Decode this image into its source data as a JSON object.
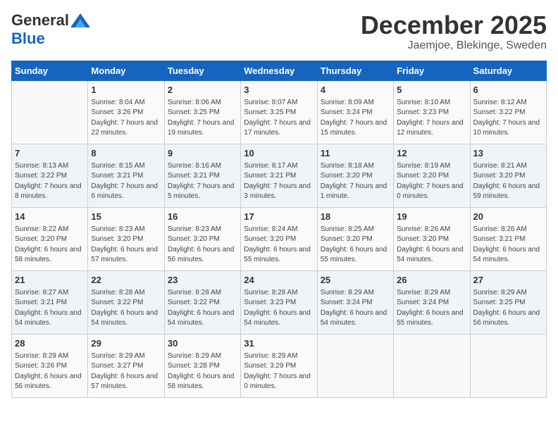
{
  "header": {
    "logo_general": "General",
    "logo_blue": "Blue",
    "month_title": "December 2025",
    "subtitle": "Jaemjoe, Blekinge, Sweden"
  },
  "weekdays": [
    "Sunday",
    "Monday",
    "Tuesday",
    "Wednesday",
    "Thursday",
    "Friday",
    "Saturday"
  ],
  "weeks": [
    [
      {
        "day": "",
        "sunrise": "",
        "sunset": "",
        "daylight": ""
      },
      {
        "day": "1",
        "sunrise": "Sunrise: 8:04 AM",
        "sunset": "Sunset: 3:26 PM",
        "daylight": "Daylight: 7 hours and 22 minutes."
      },
      {
        "day": "2",
        "sunrise": "Sunrise: 8:06 AM",
        "sunset": "Sunset: 3:25 PM",
        "daylight": "Daylight: 7 hours and 19 minutes."
      },
      {
        "day": "3",
        "sunrise": "Sunrise: 8:07 AM",
        "sunset": "Sunset: 3:25 PM",
        "daylight": "Daylight: 7 hours and 17 minutes."
      },
      {
        "day": "4",
        "sunrise": "Sunrise: 8:09 AM",
        "sunset": "Sunset: 3:24 PM",
        "daylight": "Daylight: 7 hours and 15 minutes."
      },
      {
        "day": "5",
        "sunrise": "Sunrise: 8:10 AM",
        "sunset": "Sunset: 3:23 PM",
        "daylight": "Daylight: 7 hours and 12 minutes."
      },
      {
        "day": "6",
        "sunrise": "Sunrise: 8:12 AM",
        "sunset": "Sunset: 3:22 PM",
        "daylight": "Daylight: 7 hours and 10 minutes."
      }
    ],
    [
      {
        "day": "7",
        "sunrise": "Sunrise: 8:13 AM",
        "sunset": "Sunset: 3:22 PM",
        "daylight": "Daylight: 7 hours and 8 minutes."
      },
      {
        "day": "8",
        "sunrise": "Sunrise: 8:15 AM",
        "sunset": "Sunset: 3:21 PM",
        "daylight": "Daylight: 7 hours and 6 minutes."
      },
      {
        "day": "9",
        "sunrise": "Sunrise: 8:16 AM",
        "sunset": "Sunset: 3:21 PM",
        "daylight": "Daylight: 7 hours and 5 minutes."
      },
      {
        "day": "10",
        "sunrise": "Sunrise: 8:17 AM",
        "sunset": "Sunset: 3:21 PM",
        "daylight": "Daylight: 7 hours and 3 minutes."
      },
      {
        "day": "11",
        "sunrise": "Sunrise: 8:18 AM",
        "sunset": "Sunset: 3:20 PM",
        "daylight": "Daylight: 7 hours and 1 minute."
      },
      {
        "day": "12",
        "sunrise": "Sunrise: 8:19 AM",
        "sunset": "Sunset: 3:20 PM",
        "daylight": "Daylight: 7 hours and 0 minutes."
      },
      {
        "day": "13",
        "sunrise": "Sunrise: 8:21 AM",
        "sunset": "Sunset: 3:20 PM",
        "daylight": "Daylight: 6 hours and 59 minutes."
      }
    ],
    [
      {
        "day": "14",
        "sunrise": "Sunrise: 8:22 AM",
        "sunset": "Sunset: 3:20 PM",
        "daylight": "Daylight: 6 hours and 58 minutes."
      },
      {
        "day": "15",
        "sunrise": "Sunrise: 8:23 AM",
        "sunset": "Sunset: 3:20 PM",
        "daylight": "Daylight: 6 hours and 57 minutes."
      },
      {
        "day": "16",
        "sunrise": "Sunrise: 8:23 AM",
        "sunset": "Sunset: 3:20 PM",
        "daylight": "Daylight: 6 hours and 56 minutes."
      },
      {
        "day": "17",
        "sunrise": "Sunrise: 8:24 AM",
        "sunset": "Sunset: 3:20 PM",
        "daylight": "Daylight: 6 hours and 55 minutes."
      },
      {
        "day": "18",
        "sunrise": "Sunrise: 8:25 AM",
        "sunset": "Sunset: 3:20 PM",
        "daylight": "Daylight: 6 hours and 55 minutes."
      },
      {
        "day": "19",
        "sunrise": "Sunrise: 8:26 AM",
        "sunset": "Sunset: 3:20 PM",
        "daylight": "Daylight: 6 hours and 54 minutes."
      },
      {
        "day": "20",
        "sunrise": "Sunrise: 8:26 AM",
        "sunset": "Sunset: 3:21 PM",
        "daylight": "Daylight: 6 hours and 54 minutes."
      }
    ],
    [
      {
        "day": "21",
        "sunrise": "Sunrise: 8:27 AM",
        "sunset": "Sunset: 3:21 PM",
        "daylight": "Daylight: 6 hours and 54 minutes."
      },
      {
        "day": "22",
        "sunrise": "Sunrise: 8:28 AM",
        "sunset": "Sunset: 3:22 PM",
        "daylight": "Daylight: 6 hours and 54 minutes."
      },
      {
        "day": "23",
        "sunrise": "Sunrise: 8:28 AM",
        "sunset": "Sunset: 3:22 PM",
        "daylight": "Daylight: 6 hours and 54 minutes."
      },
      {
        "day": "24",
        "sunrise": "Sunrise: 8:28 AM",
        "sunset": "Sunset: 3:23 PM",
        "daylight": "Daylight: 6 hours and 54 minutes."
      },
      {
        "day": "25",
        "sunrise": "Sunrise: 8:29 AM",
        "sunset": "Sunset: 3:24 PM",
        "daylight": "Daylight: 6 hours and 54 minutes."
      },
      {
        "day": "26",
        "sunrise": "Sunrise: 8:29 AM",
        "sunset": "Sunset: 3:24 PM",
        "daylight": "Daylight: 6 hours and 55 minutes."
      },
      {
        "day": "27",
        "sunrise": "Sunrise: 8:29 AM",
        "sunset": "Sunset: 3:25 PM",
        "daylight": "Daylight: 6 hours and 56 minutes."
      }
    ],
    [
      {
        "day": "28",
        "sunrise": "Sunrise: 8:29 AM",
        "sunset": "Sunset: 3:26 PM",
        "daylight": "Daylight: 6 hours and 56 minutes."
      },
      {
        "day": "29",
        "sunrise": "Sunrise: 8:29 AM",
        "sunset": "Sunset: 3:27 PM",
        "daylight": "Daylight: 6 hours and 57 minutes."
      },
      {
        "day": "30",
        "sunrise": "Sunrise: 8:29 AM",
        "sunset": "Sunset: 3:28 PM",
        "daylight": "Daylight: 6 hours and 58 minutes."
      },
      {
        "day": "31",
        "sunrise": "Sunrise: 8:29 AM",
        "sunset": "Sunset: 3:29 PM",
        "daylight": "Daylight: 7 hours and 0 minutes."
      },
      {
        "day": "",
        "sunrise": "",
        "sunset": "",
        "daylight": ""
      },
      {
        "day": "",
        "sunrise": "",
        "sunset": "",
        "daylight": ""
      },
      {
        "day": "",
        "sunrise": "",
        "sunset": "",
        "daylight": ""
      }
    ]
  ]
}
